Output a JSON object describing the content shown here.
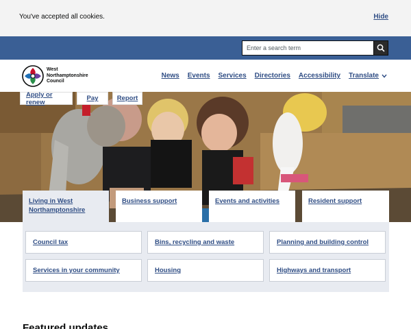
{
  "cookie": {
    "message": "You've accepted all cookies.",
    "hide_label": "Hide"
  },
  "search": {
    "placeholder": "Enter a search term",
    "icon": "search-icon"
  },
  "logo": {
    "line1": "West",
    "line2": "Northamptonshire",
    "line3": "Council"
  },
  "nav": {
    "items": [
      {
        "label": "News"
      },
      {
        "label": "Events"
      },
      {
        "label": "Services"
      },
      {
        "label": "Directories"
      },
      {
        "label": "Accessibility"
      },
      {
        "label": "Translate"
      }
    ]
  },
  "quick_links": [
    {
      "label": "Apply or renew"
    },
    {
      "label": "Pay"
    },
    {
      "label": "Report"
    }
  ],
  "tabs": [
    {
      "label": "Living in West Northamptonshire",
      "active": true
    },
    {
      "label": "Business support"
    },
    {
      "label": "Events and activities"
    },
    {
      "label": "Resident support"
    }
  ],
  "cards": [
    {
      "label": "Council tax"
    },
    {
      "label": "Bins, recycling and waste"
    },
    {
      "label": "Planning and building control"
    },
    {
      "label": "Services in your community"
    },
    {
      "label": "Housing"
    },
    {
      "label": "Highways and transport"
    }
  ],
  "featured": {
    "heading": "Featured updates"
  },
  "colors": {
    "brand_blue": "#3a5f95",
    "link": "#2f4d84",
    "panel": "#e8ebf1"
  }
}
